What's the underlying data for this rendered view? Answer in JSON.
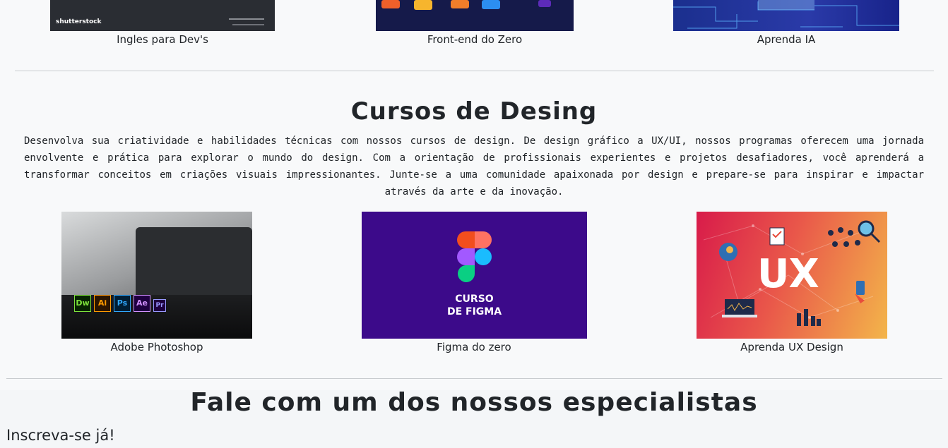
{
  "dev_courses": {
    "cards": [
      {
        "caption": "Ingles para Dev's",
        "image_icon": "shutterstock-stock-photo",
        "watermark": "shutterstock"
      },
      {
        "caption": "Front-end do Zero",
        "image_icon": "colored-code-cubes-illustration"
      },
      {
        "caption": "Aprenda IA",
        "image_icon": "circuit-board-illustration"
      }
    ]
  },
  "design_section": {
    "title": "Cursos de Desing",
    "description": "Desenvolva sua criatividade e habilidades técnicas com nossos cursos de design. De design gráfico a UX/UI, nossos programas oferecem uma jornada envolvente e prática para explorar o mundo do design. Com a orientação de profissionais experientes e projetos desafiadores, você aprenderá a transformar conceitos em criações visuais impressionantes. Junte-se a uma comunidade apaixonada por design e prepare-se para inspirar e impactar através da arte e da inovação.",
    "cards": [
      {
        "caption": "Adobe Photoshop",
        "image_icon": "laptop-adobe-apps-photo",
        "app_badges": [
          "Dw",
          "Ai",
          "Ps",
          "Ae",
          "Pr"
        ]
      },
      {
        "caption": "Figma do zero",
        "image_icon": "figma-logo",
        "image_text_line1": "CURSO",
        "image_text_line2": "DE FIGMA"
      },
      {
        "caption": "Aprenda UX Design",
        "image_icon": "ux-illustration",
        "image_text": "UX"
      }
    ]
  },
  "contact_section": {
    "title": "Fale com um dos nossos especialistas",
    "signup_text": "Inscreva-se já!"
  },
  "colors": {
    "page_bg": "#f8f9fa",
    "text": "#212529",
    "rule": "#c9cccf",
    "figma_bg": "#3c0a8a",
    "ux_gradient_start": "#d81b4a",
    "ux_gradient_end": "#f3b54a"
  }
}
